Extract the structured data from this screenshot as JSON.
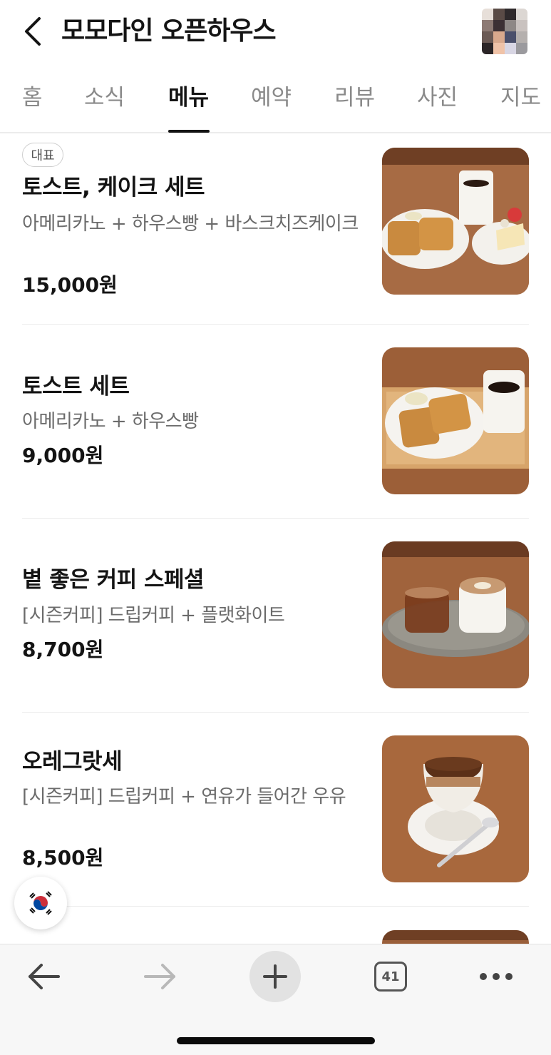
{
  "header": {
    "title": "모모다인 오픈하우스",
    "back_icon": "chevron-left-icon"
  },
  "tabs": [
    {
      "label": "홈",
      "active": false
    },
    {
      "label": "소식",
      "active": false
    },
    {
      "label": "메뉴",
      "active": true
    },
    {
      "label": "예약",
      "active": false
    },
    {
      "label": "리뷰",
      "active": false
    },
    {
      "label": "사진",
      "active": false
    },
    {
      "label": "지도",
      "active": false
    }
  ],
  "menu": [
    {
      "badge": "대표",
      "name": "토스트, 케이크 세트",
      "description": "아메리카노 + 하우스빵 + 바스크치즈케이크",
      "price": "15,000원",
      "photo": "toast-cake-set-photo"
    },
    {
      "name": "토스트 세트",
      "description": "아메리카노 + 하우스빵",
      "price": "9,000원",
      "photo": "toast-set-photo"
    },
    {
      "name": "볕 좋은 커피 스페셜",
      "description": "[시즌커피] 드립커피 + 플랫화이트",
      "price": "8,700원",
      "photo": "coffee-special-photo"
    },
    {
      "name": "오레그랏세",
      "description": "[시즌커피] 드립커피 + 연유가 들어간 우유",
      "price": "8,500원",
      "photo": "ore-glace-photo"
    }
  ],
  "language_button": {
    "icon": "korea-flag-icon"
  },
  "toolbar": {
    "back_icon": "arrow-left-icon",
    "forward_icon": "arrow-right-icon",
    "new_tab_icon": "plus-icon",
    "tab_count": "41",
    "more_icon": "more-dots-icon"
  }
}
